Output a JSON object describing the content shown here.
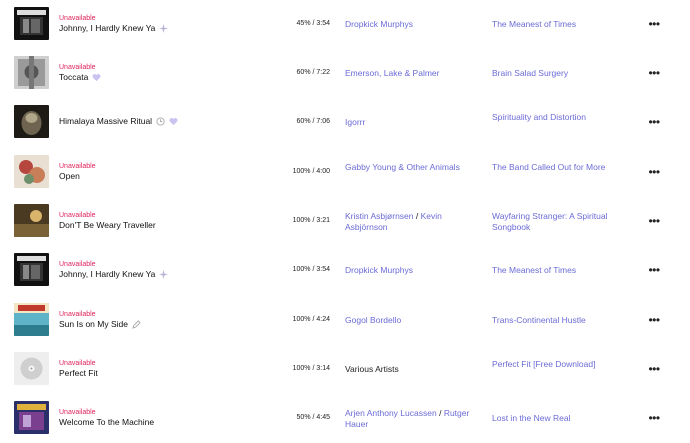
{
  "tracks": [
    {
      "status": "Unavailable",
      "title": "Johnny, I Hardly Knew Ya",
      "progress": "45% / 3:54",
      "artists": [
        "Dropkick Murphys"
      ],
      "album": "The Meanest of Times",
      "badge": "sparkle-icon",
      "art": "dropkick-cover"
    },
    {
      "status": "Unavailable",
      "title": "Toccata",
      "progress": "60% / 7:22",
      "artists": [
        "Emerson, Lake & Palmer"
      ],
      "album": "Brain Salad Surgery",
      "badge": "heart-icon",
      "art": "elp-cover"
    },
    {
      "status": "",
      "title": "Himalaya Massive Ritual",
      "progress": "60% / 7:06",
      "artists": [
        "Igorrr"
      ],
      "album": "Spirituality and Distortion",
      "badge": "clock-heart-icons",
      "art": "igorrr-cover"
    },
    {
      "status": "Unavailable",
      "title": "Open",
      "progress": "100% / 4:00",
      "artists": [
        "Gabby Young & Other Animals"
      ],
      "album": "The Band Called Out for More",
      "badge": "",
      "art": "gabby-cover"
    },
    {
      "status": "Unavailable",
      "title": "Don'T Be Weary Traveller",
      "progress": "100% / 3:21",
      "artists": [
        "Kristin Asbjørnsen",
        "Kevin Asbjörnson"
      ],
      "album": "Wayfaring Stranger: A Spiritual Songbook",
      "badge": "",
      "art": "kristin-cover"
    },
    {
      "status": "Unavailable",
      "title": "Johnny, I Hardly Knew Ya",
      "progress": "100% / 3:54",
      "artists": [
        "Dropkick Murphys"
      ],
      "album": "The Meanest of Times",
      "badge": "sparkle-icon",
      "art": "dropkick-cover"
    },
    {
      "status": "Unavailable",
      "title": "Sun Is on My Side",
      "progress": "100% / 4:24",
      "artists": [
        "Gogol Bordello"
      ],
      "album": "Trans-Continental Hustle",
      "badge": "pencil-icon",
      "art": "gogol-cover"
    },
    {
      "status": "Unavailable",
      "title": "Perfect Fit",
      "progress": "100% / 3:14",
      "artists": [
        "Various Artists"
      ],
      "artists_plain": true,
      "album": "Perfect Fit [Free Download]",
      "badge": "",
      "art": "disc-placeholder"
    },
    {
      "status": "Unavailable",
      "title": "Welcome To the Machine",
      "progress": "50% / 4:45",
      "artists": [
        "Arjen Anthony Lucassen",
        "Rutger Hauer"
      ],
      "album": "Lost in the New Real",
      "badge": "",
      "art": "arjen-cover"
    }
  ],
  "more_label": "•••",
  "artist_separator": "/",
  "colors": {
    "link": "#6b6bd6",
    "unavailable": "#e0245e",
    "badge": "#c9c3f0"
  }
}
